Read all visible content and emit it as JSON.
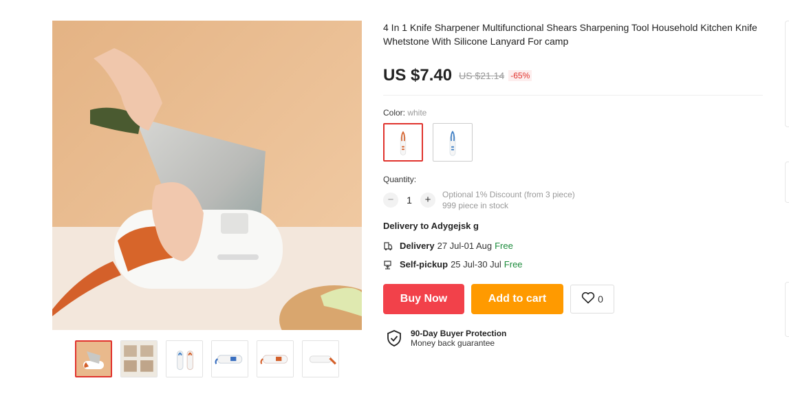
{
  "product": {
    "title": "4 In 1 Knife Sharpener Multifunctional Shears Sharpening Tool Household Kitchen Knife Whetstone With Silicone Lanyard For camp",
    "price": "US $7.40",
    "old_price": "US $21.14",
    "discount": "-65%"
  },
  "gallery": {
    "thumbnail_count": 6,
    "active_index": 0
  },
  "color": {
    "label": "Color: ",
    "selected": "white",
    "options": [
      "red-lanyard",
      "blue-lanyard"
    ]
  },
  "quantity": {
    "label": "Quantity:",
    "value": "1",
    "minus": "−",
    "plus": "+",
    "discount_note": "Optional 1% Discount (from 3 piece)",
    "stock": "999 piece in stock"
  },
  "delivery": {
    "to": "Delivery to Adygejsk g",
    "options": [
      {
        "label": "Delivery",
        "dates": "27 Jul-01 Aug",
        "cost": "Free",
        "icon": "truck-icon"
      },
      {
        "label": "Self-pickup",
        "dates": "25 Jul-30 Jul",
        "cost": "Free",
        "icon": "pickup-icon"
      }
    ]
  },
  "actions": {
    "buy_now": "Buy Now",
    "add_to_cart": "Add to cart",
    "wishlist_count": "0"
  },
  "protection": {
    "title": "90-Day Buyer Protection",
    "subtitle": "Money back guarantee"
  },
  "colors": {
    "accent_red": "#f2414a",
    "accent_orange": "#ff9a00",
    "free_green": "#1a8a3a",
    "discount_red": "#e0322c"
  }
}
